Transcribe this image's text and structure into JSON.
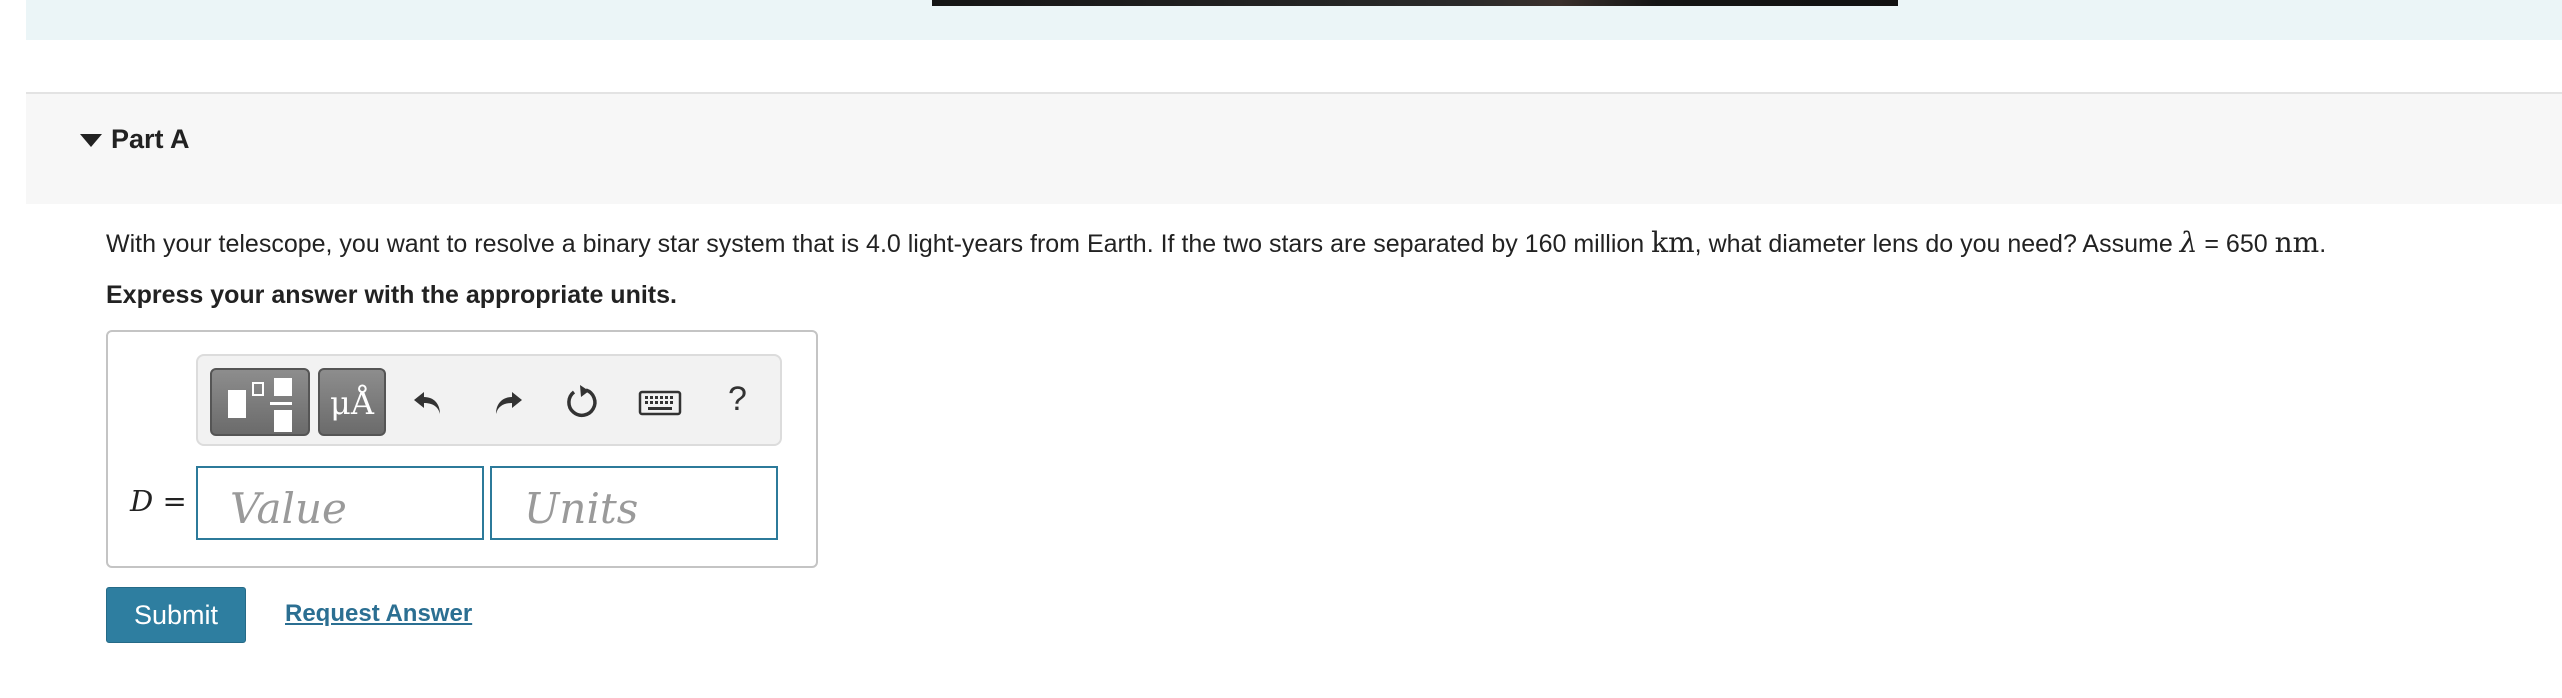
{
  "part": {
    "title": "Part A"
  },
  "question": {
    "text_1": "With your telescope, you want to resolve a binary star system that is 4.0 light-years from Earth. If the two stars are separated by 160 million ",
    "unit_km": "km",
    "text_2": ", what diameter lens do you need? Assume ",
    "lambda": "λ",
    "text_3": " = 650 ",
    "unit_nm": "nm",
    "text_4": "."
  },
  "instruction": "Express your answer with the appropriate units.",
  "toolbar": {
    "units_glyph": "μÅ",
    "help_label": "?",
    "icons": [
      "templates-icon",
      "units-icon",
      "undo-icon",
      "redo-icon",
      "reset-icon",
      "keyboard-icon",
      "help-icon"
    ]
  },
  "answer": {
    "variable": "D",
    "equals": " =",
    "value_placeholder": "Value",
    "units_placeholder": "Units"
  },
  "actions": {
    "submit_label": "Submit",
    "request_answer_label": "Request Answer"
  },
  "colors": {
    "accent": "#2e7ea0",
    "link": "#2b6f92",
    "header_bg": "#f7f7f7",
    "top_band": "#ebf5f7"
  }
}
